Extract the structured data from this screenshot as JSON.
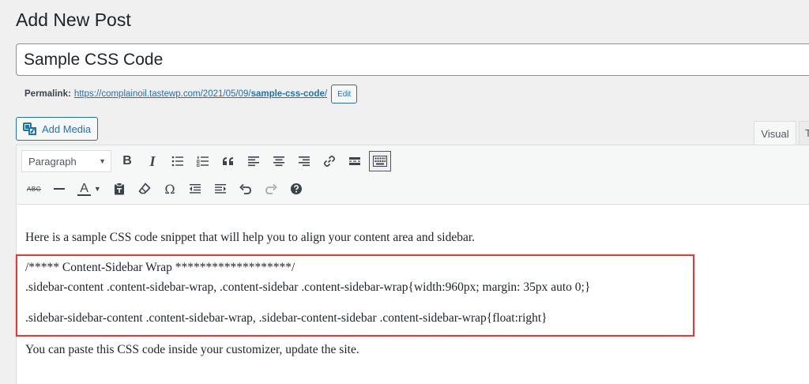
{
  "header": {
    "title": "Add New Post"
  },
  "post": {
    "title_value": "Sample CSS Code",
    "permalink_label": "Permalink:",
    "permalink_base": "https://complainoil.tastewp.com/2021/05/09/",
    "permalink_slug": "sample-css-code",
    "permalink_trail": "/",
    "edit_label": "Edit"
  },
  "media": {
    "add_media_label": "Add Media",
    "icon": "media-icon"
  },
  "tabs": {
    "visual": "Visual",
    "text": "Text"
  },
  "toolbar": {
    "format_value": "Paragraph",
    "row1_icons": [
      "bold-icon",
      "italic-icon",
      "bulleted-list-icon",
      "numbered-list-icon",
      "blockquote-icon",
      "align-left-icon",
      "align-center-icon",
      "align-right-icon",
      "link-icon",
      "read-more-icon",
      "toolbar-toggle-icon"
    ],
    "row2_icons": [
      "strikethrough-icon",
      "horizontal-line-icon",
      "text-color-icon",
      "paste-as-text-icon",
      "clear-formatting-icon",
      "special-character-icon",
      "decrease-indent-icon",
      "increase-indent-icon",
      "undo-icon",
      "redo-icon",
      "help-icon"
    ],
    "bold_glyph": "B",
    "italic_glyph": "I",
    "strike_glyph": "ABC",
    "textcolor_glyph": "A",
    "omega_glyph": "Ω"
  },
  "content": {
    "paragraph1": "Here is a sample CSS code snippet that will help you to align your content area and sidebar.",
    "code_line1": "/***** Content-Sidebar Wrap *******************/",
    "code_line2": ".sidebar-content .content-sidebar-wrap, .content-sidebar .content-sidebar-wrap{width:960px; margin: 35px auto 0;}",
    "code_line3": ".sidebar-sidebar-content .content-sidebar-wrap, .sidebar-content-sidebar .content-sidebar-wrap{float:right}",
    "paragraph2": "You can paste this CSS code inside your customizer, update the site."
  },
  "colors": {
    "accent": "#2271b1",
    "highlight_border": "#d9403a"
  }
}
